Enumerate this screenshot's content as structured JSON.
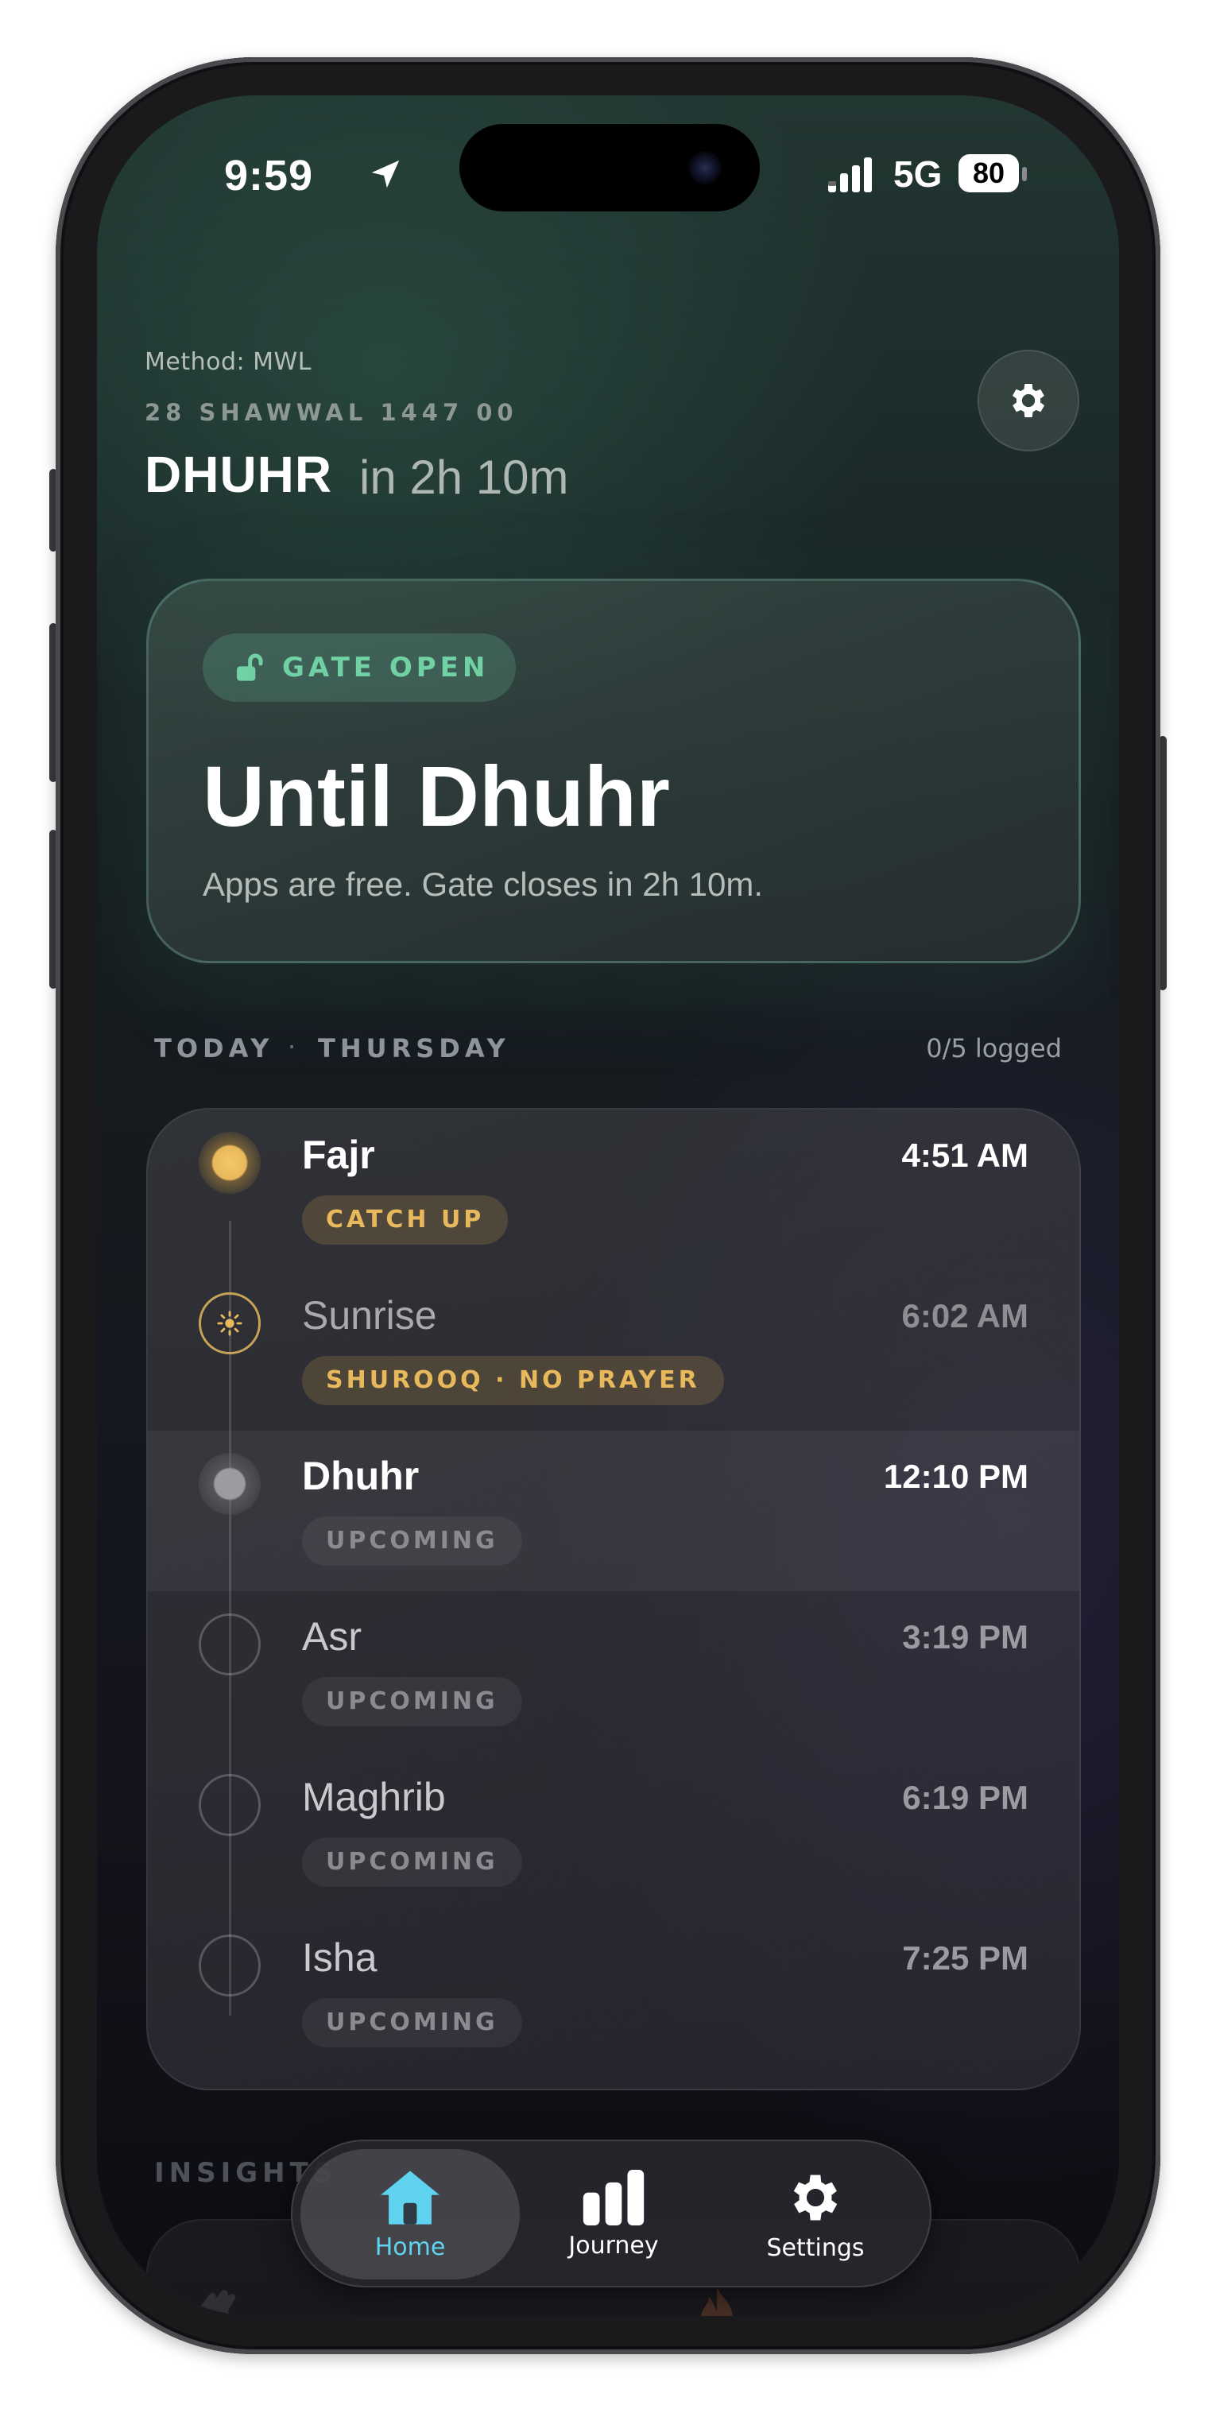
{
  "status_bar": {
    "time": "9:59",
    "network": "5G",
    "battery": "80"
  },
  "header": {
    "method": "Method: MWL",
    "hijri_date": "28 SHAWWAL 1447 00",
    "next_prayer": "DHUHR",
    "next_in": "in 2h 10m"
  },
  "gate": {
    "status": "GATE OPEN",
    "title": "Until Dhuhr",
    "subtitle": "Apps are free. Gate closes in 2h 10m."
  },
  "today": {
    "label": "TODAY",
    "separator": "·",
    "day": "THURSDAY",
    "logged": "0/5 logged"
  },
  "prayers": [
    {
      "name": "Fajr",
      "time": "4:51 AM",
      "badge": "CATCH UP",
      "state": "catch-up"
    },
    {
      "name": "Sunrise",
      "time": "6:02 AM",
      "badge": "SHUROOQ · NO PRAYER",
      "state": "sunrise"
    },
    {
      "name": "Dhuhr",
      "time": "12:10 PM",
      "badge": "UPCOMING",
      "state": "current"
    },
    {
      "name": "Asr",
      "time": "3:19 PM",
      "badge": "UPCOMING",
      "state": "upcoming"
    },
    {
      "name": "Maghrib",
      "time": "6:19 PM",
      "badge": "UPCOMING",
      "state": "upcoming"
    },
    {
      "name": "Isha",
      "time": "7:25 PM",
      "badge": "UPCOMING",
      "state": "upcoming"
    }
  ],
  "insights": {
    "label": "INSIGHTS"
  },
  "tabbar": {
    "tabs": [
      {
        "label": "Home",
        "icon": "home-icon",
        "active": true
      },
      {
        "label": "Journey",
        "icon": "bar-chart-icon",
        "active": false
      },
      {
        "label": "Settings",
        "icon": "gear-icon",
        "active": false
      }
    ]
  },
  "colors": {
    "accent_green": "#6fd1a4",
    "accent_gold": "#e7b85c",
    "tab_active": "#5fd3ef"
  }
}
